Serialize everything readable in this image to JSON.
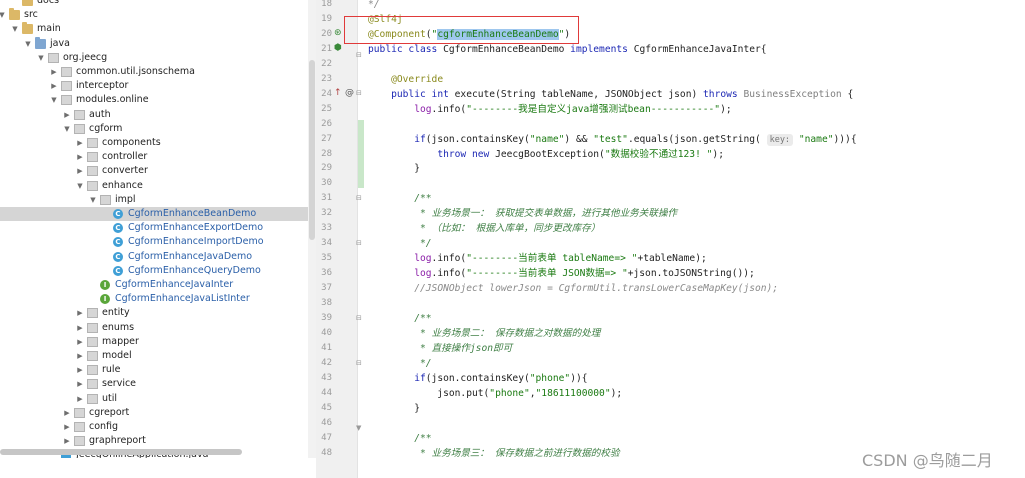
{
  "tree": {
    "rows": [
      {
        "label": "docs",
        "arrow": "",
        "icon": "folder-icon",
        "ico": "folder",
        "indent": 22,
        "selected": false
      },
      {
        "label": "src",
        "arrow": "▼",
        "icon": "folder-icon",
        "ico": "folder",
        "indent": 9,
        "selected": false
      },
      {
        "label": "main",
        "arrow": "▼",
        "icon": "folder-icon",
        "ico": "folder",
        "indent": 22,
        "selected": false
      },
      {
        "label": "java",
        "arrow": "▼",
        "icon": "source-folder-icon",
        "ico": "folder src",
        "indent": 35,
        "selected": false
      },
      {
        "label": "org.jeecg",
        "arrow": "▼",
        "icon": "package-icon",
        "ico": "pkg",
        "indent": 48,
        "selected": false
      },
      {
        "label": "common.util.jsonschema",
        "arrow": "▶",
        "icon": "package-icon",
        "ico": "pkg",
        "indent": 61,
        "selected": false
      },
      {
        "label": "interceptor",
        "arrow": "▶",
        "icon": "package-icon",
        "ico": "pkg",
        "indent": 61,
        "selected": false
      },
      {
        "label": "modules.online",
        "arrow": "▼",
        "icon": "package-icon",
        "ico": "pkg",
        "indent": 61,
        "selected": false
      },
      {
        "label": "auth",
        "arrow": "▶",
        "icon": "package-icon",
        "ico": "pkg",
        "indent": 74,
        "selected": false
      },
      {
        "label": "cgform",
        "arrow": "▼",
        "icon": "package-icon",
        "ico": "pkg",
        "indent": 74,
        "selected": false
      },
      {
        "label": "components",
        "arrow": "▶",
        "icon": "package-icon",
        "ico": "pkg",
        "indent": 87,
        "selected": false
      },
      {
        "label": "controller",
        "arrow": "▶",
        "icon": "package-icon",
        "ico": "pkg",
        "indent": 87,
        "selected": false
      },
      {
        "label": "converter",
        "arrow": "▶",
        "icon": "package-icon",
        "ico": "pkg",
        "indent": 87,
        "selected": false
      },
      {
        "label": "enhance",
        "arrow": "▼",
        "icon": "package-icon",
        "ico": "pkg",
        "indent": 87,
        "selected": false
      },
      {
        "label": "impl",
        "arrow": "▼",
        "icon": "package-icon",
        "ico": "pkg",
        "indent": 100,
        "selected": false
      },
      {
        "label": "CgformEnhanceBeanDemo",
        "arrow": "",
        "icon": "class-icon",
        "ico": "cls",
        "indent": 113,
        "selected": true
      },
      {
        "label": "CgformEnhanceExportDemo",
        "arrow": "",
        "icon": "class-icon",
        "ico": "cls",
        "indent": 113,
        "selected": false
      },
      {
        "label": "CgformEnhanceImportDemo",
        "arrow": "",
        "icon": "class-icon",
        "ico": "cls",
        "indent": 113,
        "selected": false
      },
      {
        "label": "CgformEnhanceJavaDemo",
        "arrow": "",
        "icon": "class-icon",
        "ico": "cls",
        "indent": 113,
        "selected": false
      },
      {
        "label": "CgformEnhanceQueryDemo",
        "arrow": "",
        "icon": "class-icon",
        "ico": "cls",
        "indent": 113,
        "selected": false
      },
      {
        "label": "CgformEnhanceJavaInter",
        "arrow": "",
        "icon": "interface-icon",
        "ico": "intf",
        "indent": 100,
        "selected": false
      },
      {
        "label": "CgformEnhanceJavaListInter",
        "arrow": "",
        "icon": "interface-icon",
        "ico": "intf",
        "indent": 100,
        "selected": false
      },
      {
        "label": "entity",
        "arrow": "▶",
        "icon": "package-icon",
        "ico": "pkg",
        "indent": 87,
        "selected": false
      },
      {
        "label": "enums",
        "arrow": "▶",
        "icon": "package-icon",
        "ico": "pkg",
        "indent": 87,
        "selected": false
      },
      {
        "label": "mapper",
        "arrow": "▶",
        "icon": "package-icon",
        "ico": "pkg",
        "indent": 87,
        "selected": false
      },
      {
        "label": "model",
        "arrow": "▶",
        "icon": "package-icon",
        "ico": "pkg",
        "indent": 87,
        "selected": false
      },
      {
        "label": "rule",
        "arrow": "▶",
        "icon": "package-icon",
        "ico": "pkg",
        "indent": 87,
        "selected": false
      },
      {
        "label": "service",
        "arrow": "▶",
        "icon": "package-icon",
        "ico": "pkg",
        "indent": 87,
        "selected": false
      },
      {
        "label": "util",
        "arrow": "▶",
        "icon": "package-icon",
        "ico": "pkg",
        "indent": 87,
        "selected": false
      },
      {
        "label": "cgreport",
        "arrow": "▶",
        "icon": "package-icon",
        "ico": "pkg",
        "indent": 74,
        "selected": false
      },
      {
        "label": "config",
        "arrow": "▶",
        "icon": "package-icon",
        "ico": "pkg",
        "indent": 74,
        "selected": false
      },
      {
        "label": "graphreport",
        "arrow": "▶",
        "icon": "package-icon",
        "ico": "pkg",
        "indent": 74,
        "selected": false
      },
      {
        "label": "JeecgOnlineApplication.java",
        "arrow": "",
        "icon": "java-file-icon",
        "ico": "jfile",
        "indent": 61,
        "selected": false
      }
    ]
  },
  "editor": {
    "lines": [
      {
        "n": "18",
        "html": "<span class='cmt'>*/</span>"
      },
      {
        "n": "19",
        "html": "<span class='ann'>@Slf4j</span>"
      },
      {
        "n": "20",
        "html": "<span class='ann'>@Component</span>(<span class='str'>\"<span class='hl'>cgformEnhanceBeanDemo</span>\"</span>)"
      },
      {
        "n": "21",
        "html": "<span class='kw'>public class</span> CgformEnhanceBeanDemo <span class='kw'>implements</span> CgformEnhanceJavaInter{"
      },
      {
        "n": "22",
        "html": ""
      },
      {
        "n": "23",
        "html": "    <span class='ann'>@Override</span>"
      },
      {
        "n": "24",
        "html": "    <span class='kw'>public int</span> execute(String tableName, JSONObject json) <span class='kw'>throws</span> <span class='gray'>BusinessException</span> {"
      },
      {
        "n": "25",
        "html": "        <span class='fld'>log</span>.info(<span class='str'>\"--------我是自定义java增强测试bean-----------\"</span>);"
      },
      {
        "n": "26",
        "html": ""
      },
      {
        "n": "27",
        "html": "        <span class='kw'>if</span>(json.containsKey(<span class='str'>\"name\"</span>) &amp;&amp; <span class='str'>\"test\"</span>.equals(json.getString( <span class='hint'>key:</span> <span class='str'>\"name\"</span>))){"
      },
      {
        "n": "28",
        "html": "            <span class='kw'>throw new</span> JeecgBootException(<span class='str'>\"数据校验不通过123! \"</span>);"
      },
      {
        "n": "29",
        "html": "        }"
      },
      {
        "n": "30",
        "html": ""
      },
      {
        "n": "31",
        "html": "        <span class='doc'>/**</span>"
      },
      {
        "n": "32",
        "html": "         <span class='doc'>* 业务场景一： 获取提交表单数据，进行其他业务关联操作</span>"
      },
      {
        "n": "33",
        "html": "         <span class='doc'>* （比如： 根据入库单，同步更改库存）</span>"
      },
      {
        "n": "34",
        "html": "         <span class='doc'>*/</span>"
      },
      {
        "n": "35",
        "html": "        <span class='fld'>log</span>.info(<span class='str'>\"--------当前表单 tableName=> \"</span>+tableName);"
      },
      {
        "n": "36",
        "html": "        <span class='fld'>log</span>.info(<span class='str'>\"--------当前表单 JSON数据=> \"</span>+json.toJSONString());"
      },
      {
        "n": "37",
        "html": "        <span class='cmt'>//JSONObject lowerJson = CgformUtil.transLowerCaseMapKey(json);</span>"
      },
      {
        "n": "38",
        "html": ""
      },
      {
        "n": "39",
        "html": "        <span class='doc'>/**</span>"
      },
      {
        "n": "40",
        "html": "         <span class='doc'>* 业务场景二： 保存数据之对数据的处理</span>"
      },
      {
        "n": "41",
        "html": "         <span class='doc'>* 直接操作json即可</span>"
      },
      {
        "n": "42",
        "html": "         <span class='doc'>*/</span>"
      },
      {
        "n": "43",
        "html": "        <span class='kw'>if</span>(json.containsKey(<span class='str'>\"phone\"</span>)){"
      },
      {
        "n": "44",
        "html": "            json.put(<span class='str'>\"phone\"</span>,<span class='str'>\"18611100000\"</span>);"
      },
      {
        "n": "45",
        "html": "        }"
      },
      {
        "n": "46",
        "html": ""
      },
      {
        "n": "47",
        "html": "        <span class='doc'>/**</span>"
      },
      {
        "n": "48",
        "html": "         <span class='doc'>* 业务场景三： 保存数据之前进行数据的校验</span>"
      }
    ]
  },
  "watermark": "CSDN @鸟随二月"
}
